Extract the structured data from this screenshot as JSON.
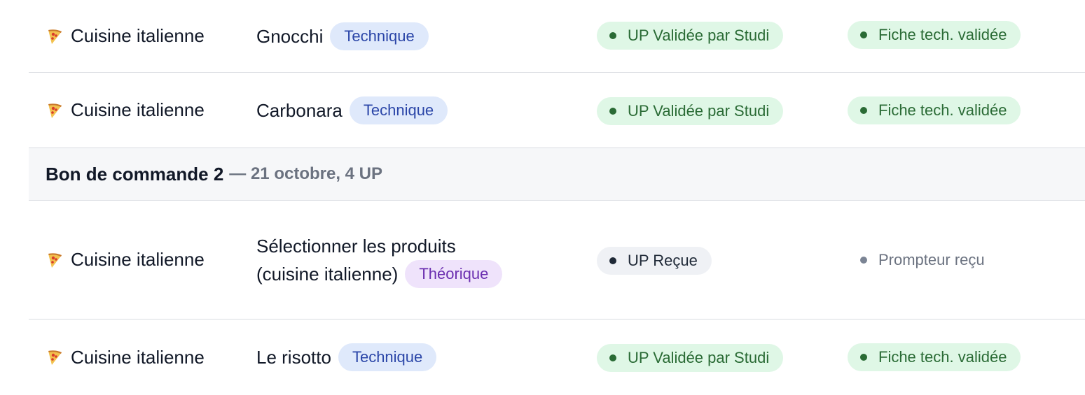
{
  "rows_top": [
    {
      "category_label": "Cuisine italienne",
      "category_icon": "pizza-icon",
      "name": "Gnocchi",
      "type_badge": "Technique",
      "up_status": "UP Validée par Studi",
      "sheet_status": "Fiche tech. validée"
    },
    {
      "category_label": "Cuisine italienne",
      "category_icon": "pizza-icon",
      "name": "Carbonara",
      "type_badge": "Technique",
      "up_status": "UP Validée par Studi",
      "sheet_status": "Fiche tech. validée"
    }
  ],
  "group": {
    "title": "Bon de commande 2",
    "meta": "— 21 octobre, 4 UP"
  },
  "rows_bottom": [
    {
      "category_label": "Cuisine italienne",
      "category_icon": "pizza-icon",
      "name_line1": "Sélectionner les produits",
      "name_line2": "(cuisine italienne)",
      "type_badge": "Théorique",
      "up_status": "UP Reçue",
      "sheet_status": "Prompteur reçu"
    },
    {
      "category_label": "Cuisine italienne",
      "category_icon": "pizza-icon",
      "name": "Le risotto",
      "type_badge": "Technique",
      "up_status": "UP Validée par Studi",
      "sheet_status": "Fiche tech. validée"
    }
  ],
  "colors": {
    "technique_bg": "#dfe9fb",
    "technique_text": "#2b46a8",
    "theorique_bg": "#efe3fb",
    "theorique_text": "#6b2fb0",
    "validated_bg": "#dff7e6",
    "validated_text": "#2a6b35"
  }
}
